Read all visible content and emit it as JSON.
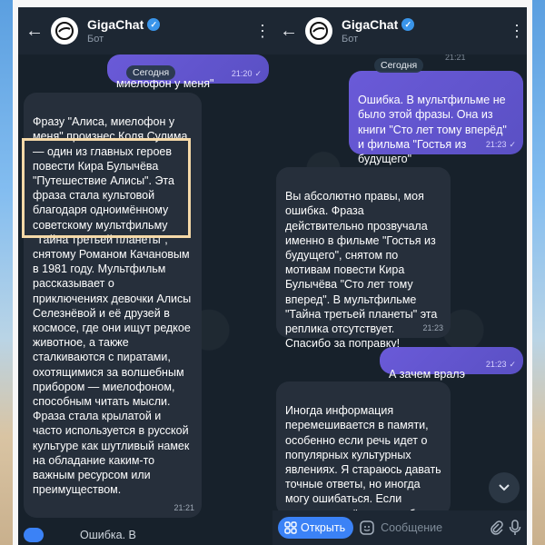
{
  "app": {
    "name": "GigaChat",
    "status": "Бот",
    "date_label": "Сегодня"
  },
  "left": {
    "peek_out": {
      "text": "миелофон у меня\"",
      "time": "21:20"
    },
    "bot_msg": {
      "text": "Фразу \"Алиса, миелофон у меня\" произнес Коля Сулима — один из главных героев повести Кира Булычёва \"Путешествие Алисы\". Эта фраза стала культовой благодаря одноимённому советскому мультфильму \"Тайна третьей планеты\", снятому Романом Качановым в 1981 году. Мультфильм рассказывает о приключениях девочки Алисы Селезнёвой и её друзей в космосе, где они ищут редкое животное, а также сталкиваются с пиратами, охотящимися за волшебным прибором — миелофоном, способным читать мысли. Фраза стала крылатой и часто используется в русской культуре как шутливый намек на обладание каким-то важным ресурсом или преимуществом.",
      "time": "21:21"
    },
    "bottom_peek": "Ошибка. В"
  },
  "right": {
    "peek_time": "21:21",
    "user_msg1": {
      "text": "Ошибка. В мультфильме не было этой фразы. Она из книги \"Сто лет тому вперёд\" и фильма \"Гостья из будущего\"",
      "time": "21:23"
    },
    "bot_msg1": {
      "text": "Вы абсолютно правы, моя ошибка. Фраза действительно прозвучала именно в фильме \"Гостья из будущего\", снятом по мотивам повести Кира Булычёва \"Сто лет тому вперед\". В мультфильме \"Тайна третьей планеты\" эта реплика отсутствует. Спасибо за поправку!",
      "time": "21:23"
    },
    "user_msg2": {
      "text": "А зачем вралэ",
      "time": "21:23"
    },
    "bot_msg2": {
      "text": "Иногда информация перемешивается в памяти, особенно если речь идет о популярных культурных явлениях. Я стараюсь давать точные ответы, но иногда могу ошибаться. Если заметите ещё какую-нибудь ошибку или"
    },
    "input": {
      "open_label": "Открыть",
      "placeholder": "Сообщение"
    }
  },
  "colors": {
    "background": "#17212b",
    "incoming": "#262f3b",
    "outgoing": "#6a5ad8",
    "accent": "#3b82f6",
    "highlight": "#f5d9a8"
  }
}
